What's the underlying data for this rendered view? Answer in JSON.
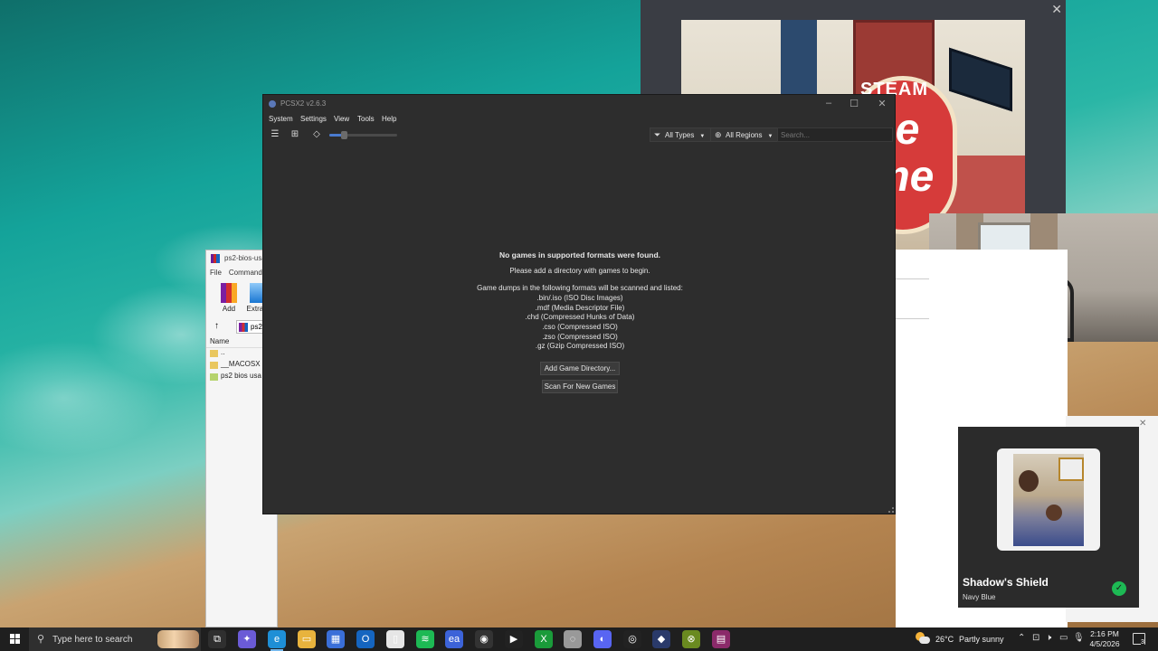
{
  "pcsx2": {
    "title": "PCSX2 v2.6.3",
    "menu": [
      "System",
      "Settings",
      "View",
      "Tools",
      "Help"
    ],
    "toolbar": {
      "list_view_icon": "list-icon",
      "grid_view_icon": "grid-icon",
      "cover_icon": "tag-icon",
      "type_filter": "All Types",
      "region_filter": "All Regions",
      "search_placeholder": "Search..."
    },
    "empty": {
      "heading": "No games in supported formats were found.",
      "prompt": "Please add a directory with games to begin.",
      "formats_intro": "Game dumps in the following formats will be scanned and listed:",
      "formats": [
        ".bin/.iso (ISO Disc Images)",
        ".mdf (Media Descriptor File)",
        ".chd (Compressed Hunks of Data)",
        ".cso (Compressed ISO)",
        ".zso (Compressed ISO)",
        ".gz (Gzip Compressed ISO)"
      ],
      "add_button": "Add Game Directory...",
      "scan_button": "Scan For New Games"
    }
  },
  "winrar": {
    "title": "ps2-bios-usa",
    "menu": [
      "File",
      "Commands"
    ],
    "tools": [
      "Add",
      "Extract"
    ],
    "address": "ps2",
    "column_name": "Name",
    "rows": [
      "..",
      "__MACOSX",
      "ps2 bios usa"
    ]
  },
  "steam_art": {
    "word1": "STEAM",
    "word2": "se",
    "word3": "me"
  },
  "notification": {
    "title": "Shadow's Shield",
    "subtitle": "Navy Blue",
    "accent": "#1db954"
  },
  "taskbar": {
    "search_placeholder": "Type here to search",
    "weather": "26°C",
    "weather_desc": "Partly sunny",
    "time": "2:16 PM",
    "date": "4/5/2026",
    "notification_count": "3",
    "apps": [
      {
        "name": "task-view-icon",
        "glyph": "⧉",
        "color": "#2f2f2f"
      },
      {
        "name": "copilot-icon",
        "glyph": "✦",
        "color": "#6b5bd6"
      },
      {
        "name": "edge-icon",
        "glyph": "e",
        "color": "#1e8fd6"
      },
      {
        "name": "file-explorer-icon",
        "glyph": "▭",
        "color": "#e8b33d"
      },
      {
        "name": "store-icon",
        "glyph": "▦",
        "color": "#3a6fd8"
      },
      {
        "name": "outlook-icon",
        "glyph": "O",
        "color": "#1565c0"
      },
      {
        "name": "notepad-icon",
        "glyph": "▯",
        "color": "#e6e6e6"
      },
      {
        "name": "spotify-icon",
        "glyph": "≋",
        "color": "#1db954"
      },
      {
        "name": "ea-icon",
        "glyph": "ea",
        "color": "#3c63d8"
      },
      {
        "name": "gamepad-icon",
        "glyph": "◉",
        "color": "#333"
      },
      {
        "name": "play-icon",
        "glyph": "▶",
        "color": "#222"
      },
      {
        "name": "xbox-icon",
        "glyph": "X",
        "color": "#1a9b3a"
      },
      {
        "name": "phone-icon",
        "glyph": "◌",
        "color": "#999"
      },
      {
        "name": "discord-icon",
        "glyph": "◐",
        "color": "#5865f2"
      },
      {
        "name": "steam-icon",
        "glyph": "◎",
        "color": "#222"
      },
      {
        "name": "pcsx2-icon",
        "glyph": "◆",
        "color": "#2a3a6a"
      },
      {
        "name": "xbox-app-icon",
        "glyph": "⊗",
        "color": "#6a8a20"
      },
      {
        "name": "winrar-icon",
        "glyph": "▤",
        "color": "#8b2a6a"
      }
    ]
  }
}
